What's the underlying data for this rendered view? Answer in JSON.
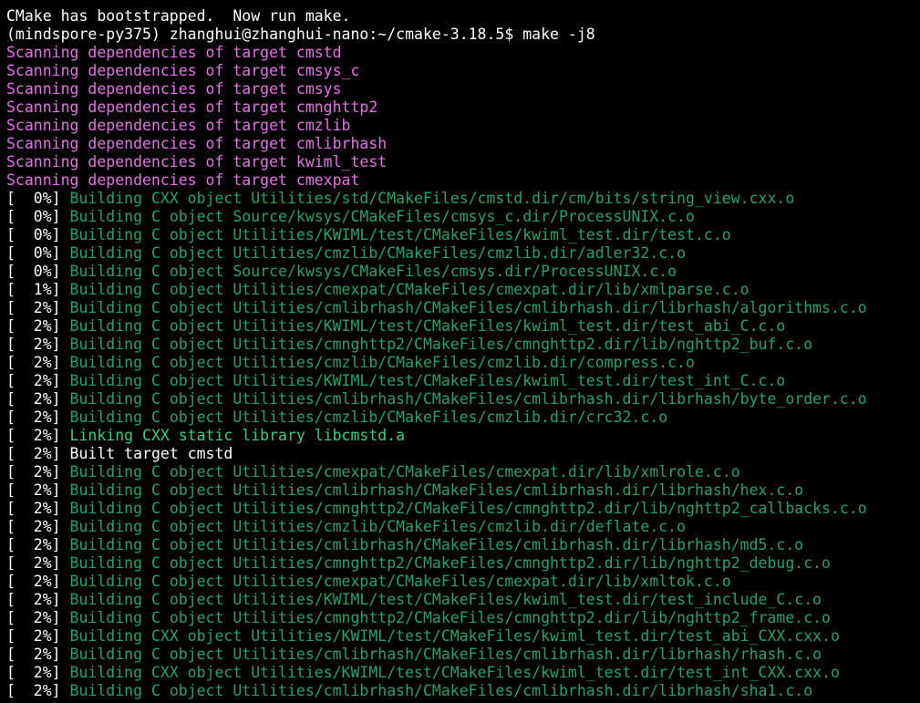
{
  "colors": {
    "background": "#000000",
    "plain": "#ffffff",
    "magenta": "#e373e3",
    "green": "#26a269",
    "bright_green": "#33d17a"
  },
  "terminal": {
    "lines": [
      {
        "prefix": "",
        "text": "CMake has bootstrapped.  Now run make.",
        "style": "plain"
      },
      {
        "prefix": "",
        "text": "(mindspore-py375) zhanghui@zhanghui-nano:~/cmake-3.18.5$ make -j8",
        "style": "plain"
      },
      {
        "prefix": "",
        "text": "Scanning dependencies of target cmstd",
        "style": "magenta"
      },
      {
        "prefix": "",
        "text": "Scanning dependencies of target cmsys_c",
        "style": "magenta"
      },
      {
        "prefix": "",
        "text": "Scanning dependencies of target cmsys",
        "style": "magenta"
      },
      {
        "prefix": "",
        "text": "Scanning dependencies of target cmnghttp2",
        "style": "magenta"
      },
      {
        "prefix": "",
        "text": "Scanning dependencies of target cmzlib",
        "style": "magenta"
      },
      {
        "prefix": "",
        "text": "Scanning dependencies of target cmlibrhash",
        "style": "magenta"
      },
      {
        "prefix": "",
        "text": "Scanning dependencies of target kwiml_test",
        "style": "magenta"
      },
      {
        "prefix": "",
        "text": "Scanning dependencies of target cmexpat",
        "style": "magenta"
      },
      {
        "prefix": "[  0%] ",
        "text": "Building CXX object Utilities/std/CMakeFiles/cmstd.dir/cm/bits/string_view.cxx.o",
        "style": "green"
      },
      {
        "prefix": "[  0%] ",
        "text": "Building C object Source/kwsys/CMakeFiles/cmsys_c.dir/ProcessUNIX.c.o",
        "style": "green"
      },
      {
        "prefix": "[  0%] ",
        "text": "Building C object Utilities/KWIML/test/CMakeFiles/kwiml_test.dir/test.c.o",
        "style": "green"
      },
      {
        "prefix": "[  0%] ",
        "text": "Building C object Utilities/cmzlib/CMakeFiles/cmzlib.dir/adler32.c.o",
        "style": "green"
      },
      {
        "prefix": "[  0%] ",
        "text": "Building C object Source/kwsys/CMakeFiles/cmsys.dir/ProcessUNIX.c.o",
        "style": "green"
      },
      {
        "prefix": "[  1%] ",
        "text": "Building C object Utilities/cmexpat/CMakeFiles/cmexpat.dir/lib/xmlparse.c.o",
        "style": "green"
      },
      {
        "prefix": "[  2%] ",
        "text": "Building C object Utilities/cmlibrhash/CMakeFiles/cmlibrhash.dir/librhash/algorithms.c.o",
        "style": "green"
      },
      {
        "prefix": "[  2%] ",
        "text": "Building C object Utilities/KWIML/test/CMakeFiles/kwiml_test.dir/test_abi_C.c.o",
        "style": "green"
      },
      {
        "prefix": "[  2%] ",
        "text": "Building C object Utilities/cmnghttp2/CMakeFiles/cmnghttp2.dir/lib/nghttp2_buf.c.o",
        "style": "green"
      },
      {
        "prefix": "[  2%] ",
        "text": "Building C object Utilities/cmzlib/CMakeFiles/cmzlib.dir/compress.c.o",
        "style": "green"
      },
      {
        "prefix": "[  2%] ",
        "text": "Building C object Utilities/KWIML/test/CMakeFiles/kwiml_test.dir/test_int_C.c.o",
        "style": "green"
      },
      {
        "prefix": "[  2%] ",
        "text": "Building C object Utilities/cmlibrhash/CMakeFiles/cmlibrhash.dir/librhash/byte_order.c.o",
        "style": "green"
      },
      {
        "prefix": "[  2%] ",
        "text": "Building C object Utilities/cmzlib/CMakeFiles/cmzlib.dir/crc32.c.o",
        "style": "green"
      },
      {
        "prefix": "[  2%] ",
        "text": "Linking CXX static library libcmstd.a",
        "style": "bgreen"
      },
      {
        "prefix": "[  2%] ",
        "text": "Built target cmstd",
        "style": "plain"
      },
      {
        "prefix": "[  2%] ",
        "text": "Building C object Utilities/cmexpat/CMakeFiles/cmexpat.dir/lib/xmlrole.c.o",
        "style": "green"
      },
      {
        "prefix": "[  2%] ",
        "text": "Building C object Utilities/cmlibrhash/CMakeFiles/cmlibrhash.dir/librhash/hex.c.o",
        "style": "green"
      },
      {
        "prefix": "[  2%] ",
        "text": "Building C object Utilities/cmnghttp2/CMakeFiles/cmnghttp2.dir/lib/nghttp2_callbacks.c.o",
        "style": "green"
      },
      {
        "prefix": "[  2%] ",
        "text": "Building C object Utilities/cmzlib/CMakeFiles/cmzlib.dir/deflate.c.o",
        "style": "green"
      },
      {
        "prefix": "[  2%] ",
        "text": "Building C object Utilities/cmlibrhash/CMakeFiles/cmlibrhash.dir/librhash/md5.c.o",
        "style": "green"
      },
      {
        "prefix": "[  2%] ",
        "text": "Building C object Utilities/cmnghttp2/CMakeFiles/cmnghttp2.dir/lib/nghttp2_debug.c.o",
        "style": "green"
      },
      {
        "prefix": "[  2%] ",
        "text": "Building C object Utilities/cmexpat/CMakeFiles/cmexpat.dir/lib/xmltok.c.o",
        "style": "green"
      },
      {
        "prefix": "[  2%] ",
        "text": "Building C object Utilities/KWIML/test/CMakeFiles/kwiml_test.dir/test_include_C.c.o",
        "style": "green"
      },
      {
        "prefix": "[  2%] ",
        "text": "Building C object Utilities/cmnghttp2/CMakeFiles/cmnghttp2.dir/lib/nghttp2_frame.c.o",
        "style": "green"
      },
      {
        "prefix": "[  2%] ",
        "text": "Building CXX object Utilities/KWIML/test/CMakeFiles/kwiml_test.dir/test_abi_CXX.cxx.o",
        "style": "green"
      },
      {
        "prefix": "[  2%] ",
        "text": "Building C object Utilities/cmlibrhash/CMakeFiles/cmlibrhash.dir/librhash/rhash.c.o",
        "style": "green"
      },
      {
        "prefix": "[  2%] ",
        "text": "Building CXX object Utilities/KWIML/test/CMakeFiles/kwiml_test.dir/test_int_CXX.cxx.o",
        "style": "green"
      },
      {
        "prefix": "[  2%] ",
        "text": "Building C object Utilities/cmlibrhash/CMakeFiles/cmlibrhash.dir/librhash/sha1.c.o",
        "style": "green"
      }
    ]
  }
}
